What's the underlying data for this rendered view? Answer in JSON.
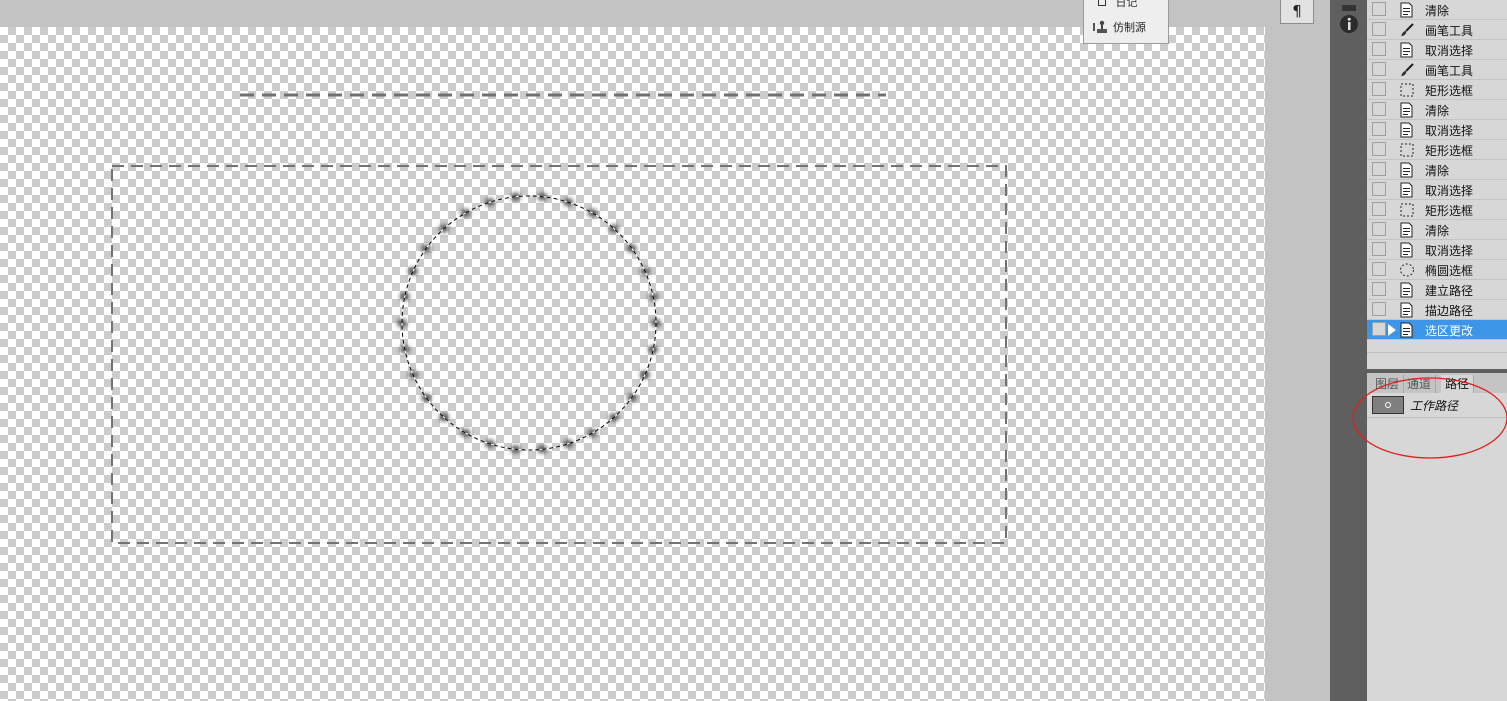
{
  "clone_popup": {
    "top_item": "日记",
    "item": "仿制源"
  },
  "paragraph_button": "¶",
  "dock": {
    "icons": [
      "history-icon",
      "info-icon"
    ]
  },
  "history": {
    "items": [
      {
        "label": "清除",
        "icon": "document-icon"
      },
      {
        "label": "画笔工具",
        "icon": "brush-icon"
      },
      {
        "label": "取消选择",
        "icon": "document-icon"
      },
      {
        "label": "画笔工具",
        "icon": "brush-icon"
      },
      {
        "label": "矩形选框",
        "icon": "rect-marquee-icon"
      },
      {
        "label": "清除",
        "icon": "document-icon"
      },
      {
        "label": "取消选择",
        "icon": "document-icon"
      },
      {
        "label": "矩形选框",
        "icon": "rect-marquee-icon"
      },
      {
        "label": "清除",
        "icon": "document-icon"
      },
      {
        "label": "取消选择",
        "icon": "document-icon"
      },
      {
        "label": "矩形选框",
        "icon": "rect-marquee-icon"
      },
      {
        "label": "清除",
        "icon": "document-icon"
      },
      {
        "label": "取消选择",
        "icon": "document-icon"
      },
      {
        "label": "椭圆选框",
        "icon": "ellipse-marquee-icon"
      },
      {
        "label": "建立路径",
        "icon": "document-icon"
      },
      {
        "label": "描边路径",
        "icon": "document-icon"
      },
      {
        "label": "选区更改",
        "icon": "document-icon"
      }
    ],
    "active_label": "选区更改"
  },
  "panel_tabs": [
    {
      "label": "图层",
      "active": false
    },
    {
      "label": "通道",
      "active": false
    },
    {
      "label": "路径",
      "active": true
    }
  ],
  "paths": {
    "items": [
      {
        "label": "工作路径"
      }
    ]
  },
  "colors": {
    "selected": "#3c95e6",
    "annotation": "#e02020",
    "dock": "#5f5f5f"
  }
}
